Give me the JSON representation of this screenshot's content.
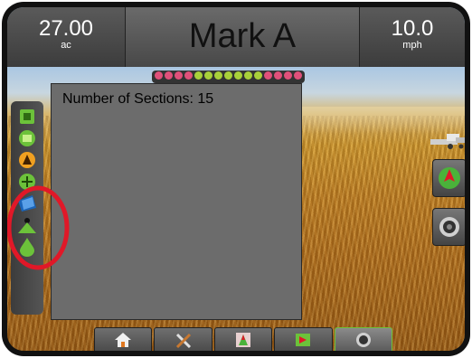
{
  "header": {
    "area": {
      "value": "27.00",
      "unit": "ac"
    },
    "title": "Mark A",
    "speed": {
      "value": "10.0",
      "unit": "mph"
    }
  },
  "boom_leds": {
    "count": 15,
    "colors": [
      "#e0507a",
      "#e0507a",
      "#e0507a",
      "#e0507a",
      "#a8d03a",
      "#a8d03a",
      "#a8d03a",
      "#a8d03a",
      "#a8d03a",
      "#a8d03a",
      "#a8d03a",
      "#e0507a",
      "#e0507a",
      "#e0507a",
      "#e0507a"
    ]
  },
  "panel": {
    "sections_text": "Number of Sections: 15"
  },
  "side_toolbar": {
    "items": [
      "boom-width-icon",
      "section-icon",
      "guidance-mode-icon",
      "pattern-icon",
      "tilt-icon",
      "marker-icon",
      "droplet-icon"
    ]
  },
  "right_buttons": [
    "compass-icon",
    "camera-icon"
  ],
  "bottom_tabs": [
    "home-icon",
    "tools-icon",
    "vehicle-view-icon",
    "field-view-icon",
    "camera-view-icon"
  ],
  "colors": {
    "accent_green": "#6cc23a",
    "highlight_red": "#e01828"
  }
}
